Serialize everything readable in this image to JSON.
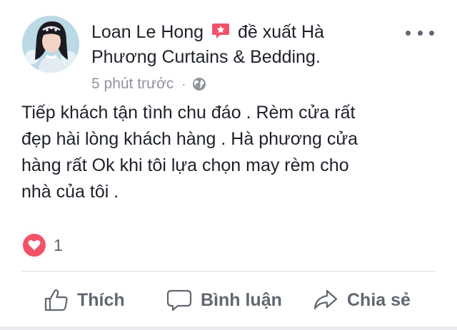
{
  "post": {
    "author": "Loan Le Hong",
    "action_text": "đề xuất",
    "page_name_line1": "Hà",
    "page_name_line2": "Phương Curtains & Bedding.",
    "timestamp": "5 phút trước",
    "separator": "·",
    "privacy_icon": "globe-icon",
    "recommend_icon": "recommend-star-icon",
    "body_lines": [
      "Tiếp khách tận tình chu đáo . Rèm cửa rất",
      "đẹp hài lòng khách hàng . Hà phương cửa",
      "hàng rất Ok khi tôi lựa chọn may rèm cho",
      "nhà của tôi ."
    ]
  },
  "reactions": {
    "icon": "heart-icon",
    "count": "1"
  },
  "actions": {
    "like_label": "Thích",
    "comment_label": "Bình luận",
    "share_label": "Chia sẻ"
  },
  "colors": {
    "text": "#1d2129",
    "meta": "#90949c",
    "action": "#606770",
    "heart": "#f25268",
    "recommend": "#f25268"
  }
}
